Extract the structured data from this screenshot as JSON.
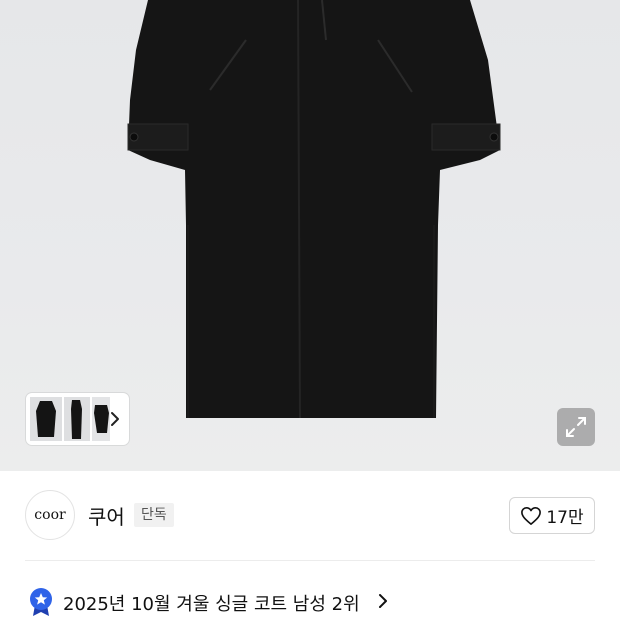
{
  "gallery": {
    "thumbnail_icons": [
      "coat-front-thumbnail",
      "coat-side-thumbnail",
      "coat-back-thumbnail"
    ],
    "next_icon": "chevron-right-icon",
    "expand_icon": "expand-icon"
  },
  "brand": {
    "logo_text": "coor",
    "name": "쿠어",
    "badge": "단독"
  },
  "like": {
    "icon": "heart-outline-icon",
    "count": "17만"
  },
  "ranking": {
    "icon": "award-badge-icon",
    "text": "2025년 10월 겨울 싱글 코트 남성 2위",
    "chevron_icon": "chevron-right-icon"
  },
  "colors": {
    "background": "#e8e9eb",
    "coat": "#151515",
    "badge_blue": "#2f63e8"
  }
}
